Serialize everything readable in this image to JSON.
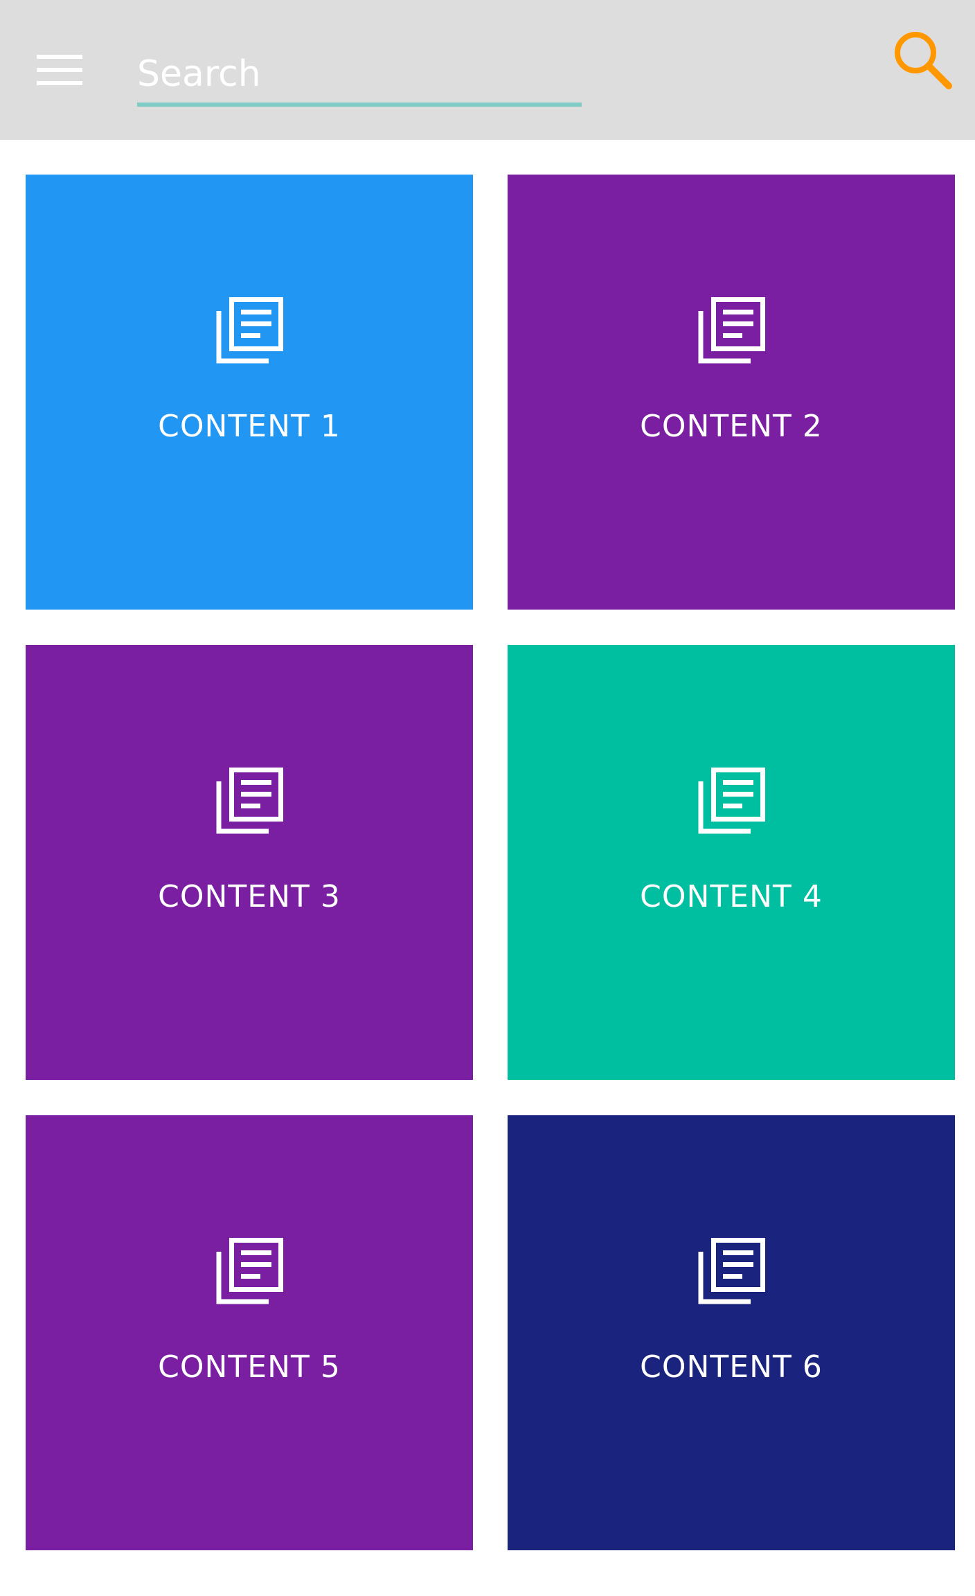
{
  "header": {
    "menu_icon": "hamburger-menu-icon",
    "search_placeholder": "Search",
    "search_icon": "search-icon",
    "colors": {
      "bar_background": "#dddddd",
      "underline": "#80cbc4",
      "search_icon": "#ff9800"
    }
  },
  "tiles": [
    {
      "label": "CONTENT 1",
      "icon": "library-books-icon",
      "color": "#2196f3"
    },
    {
      "label": "CONTENT 2",
      "icon": "library-books-icon",
      "color": "#7b1fa2"
    },
    {
      "label": "CONTENT 3",
      "icon": "library-books-icon",
      "color": "#7b1fa2"
    },
    {
      "label": "CONTENT 4",
      "icon": "library-books-icon",
      "color": "#00bfa0"
    },
    {
      "label": "CONTENT 5",
      "icon": "library-books-icon",
      "color": "#7b1fa2"
    },
    {
      "label": "CONTENT 6",
      "icon": "library-books-icon",
      "color": "#1a237e"
    }
  ]
}
